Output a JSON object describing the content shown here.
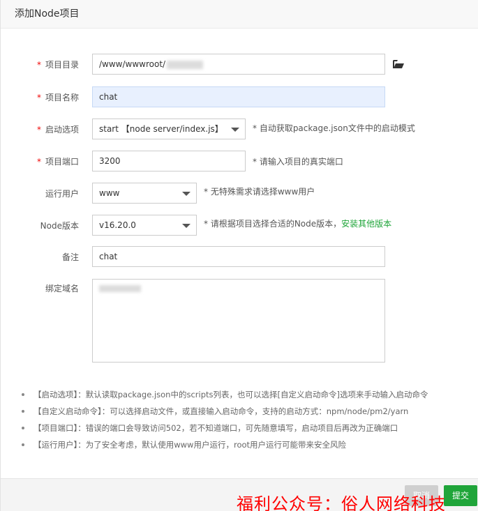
{
  "dialog": {
    "title": "添加Node项目"
  },
  "form": {
    "required_mark": "*",
    "project_dir": {
      "label": "项目目录",
      "value": "/www/wwwroot/"
    },
    "project_name": {
      "label": "项目名称",
      "value": "chat"
    },
    "start_option": {
      "label": "启动选项",
      "selected": "start 【node server/index.js】",
      "hint": "* 自动获取package.json文件中的启动模式"
    },
    "project_port": {
      "label": "项目端口",
      "value": "3200",
      "hint": "* 请输入项目的真实端口"
    },
    "run_user": {
      "label": "运行用户",
      "selected": "www",
      "hint": "* 无特殊需求请选择www用户"
    },
    "node_version": {
      "label": "Node版本",
      "selected": "v16.20.0",
      "hint": "* 请根据项目选择合适的Node版本，",
      "link": "安装其他版本"
    },
    "remark": {
      "label": "备注",
      "value": "chat"
    },
    "bind_domain": {
      "label": "绑定域名"
    }
  },
  "tips": [
    "【启动选项】：默认读取package.json中的scripts列表，也可以选择[自定义启动命令]选项来手动输入启动命令",
    "【自定义启动命令】：可以选择启动文件，或直接输入启动命令，支持的启动方式：npm/node/pm2/yarn",
    "【项目端口】：错误的端口会导致访问502，若不知道端口，可先随意填写，启动项目后再改为正确端口",
    "【运行用户】：为了安全考虑，默认使用www用户运行，root用户运行可能带来安全风险"
  ],
  "footer": {
    "cancel_label": "取消",
    "submit_label": "提交"
  },
  "watermark": "福利公众号：俗人网络科技",
  "colors": {
    "accent_green": "#20a53a",
    "required_red": "#ef0808",
    "watermark_red": "#ff0000"
  },
  "icons": {
    "folder": "folder-open-icon"
  }
}
